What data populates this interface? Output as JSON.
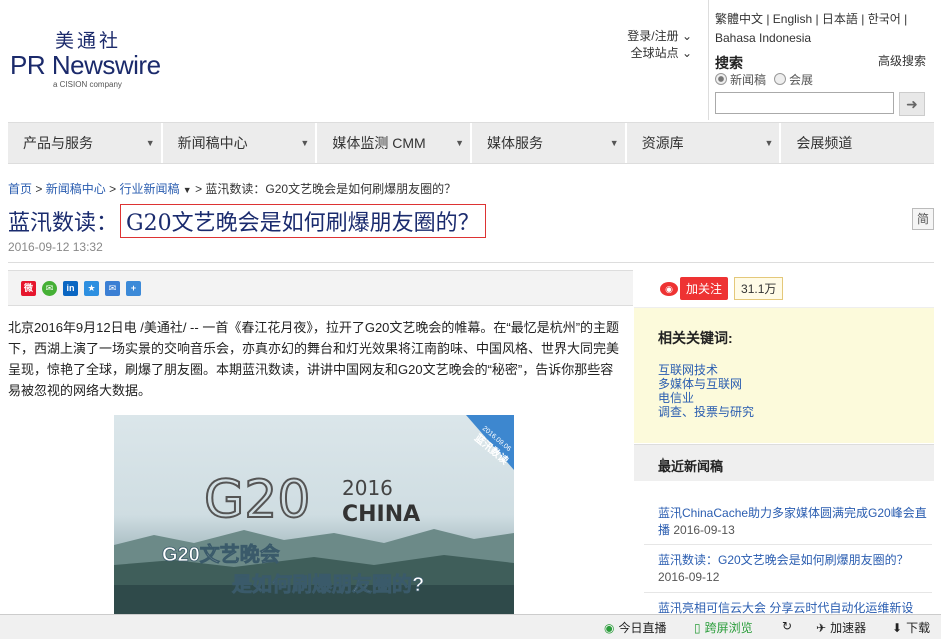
{
  "header": {
    "logo_cn": "美通社",
    "logo_en": "PR Newswire",
    "logo_sub": "a CISION company",
    "login": "登录/注册",
    "global_sites": "全球站点",
    "languages": "繁體中文 | English | 日本語 | 한국어 | Bahasa Indonesia",
    "search_title": "搜索",
    "advanced_search": "高级搜索",
    "radio_news": "新闻稿",
    "radio_expo": "会展"
  },
  "nav": [
    "产品与服务",
    "新闻稿中心",
    "媒体监测 CMM",
    "媒体服务",
    "资源库",
    "会展频道"
  ],
  "breadcrumb": {
    "home": "首页",
    "news_center": "新闻稿中心",
    "industry": "行业新闻稿",
    "current": "蓝汛数读：G20文艺晚会是如何刷爆朋友圈的？",
    "sep": ">"
  },
  "article": {
    "title_prefix": "蓝汛数读：",
    "title_main": "G20文艺晚会是如何刷爆朋友圈的？",
    "date": "2016-09-12 13:32",
    "simplified_btn": "简",
    "body": "北京2016年9月12日电 /美通社/ -- 一首《春江花月夜》，拉开了G20文艺晚会的帷幕。在“最忆是杭州”的主题下，西湖上演了一场实景的交响音乐会，亦真亦幻的舞台和灯光效果将江南韵味、中国风格、世界大同完美呈现，惊艳了全球，刷爆了朋友圈。本期蓝汛数读，讲讲中国网友和G20文艺晚会的“秘密”，告诉你那些容易被忽视的网络大数据。",
    "image": {
      "badge_date": "2016.09.06",
      "badge_text": "蓝汛数读",
      "g20": "G20",
      "year": "2016",
      "china": "CHINA",
      "line1": "G20文艺晚会",
      "line2": "是如何刷爆朋友圈的?"
    }
  },
  "sidebar": {
    "follow": "加关注",
    "followers": "31.1万",
    "related_title": "相关关键词:",
    "related": [
      "互联网技术",
      "多媒体与互联网",
      "电信业",
      "调查、投票与研究"
    ],
    "latest_title": "最近新闻稿",
    "latest": [
      {
        "title": "蓝汛ChinaCache助力多家媒体圆满完成G20峰会直播",
        "date": "2016-09-13"
      },
      {
        "title": "蓝汛数读：G20文艺晚会是如何刷爆朋友圈的？",
        "date": "2016-09-12"
      },
      {
        "title": "蓝汛亮相可信云大会 分享云时代自动化运维新设",
        "date": ""
      }
    ]
  },
  "statusbar": {
    "live": "今日直播",
    "cross_screen": "跨屏浏览",
    "accelerator": "加速器",
    "download": "下载"
  },
  "colors": {
    "brand": "#1b2a6b",
    "link": "#2a5db0",
    "title_border": "#dd3333"
  }
}
